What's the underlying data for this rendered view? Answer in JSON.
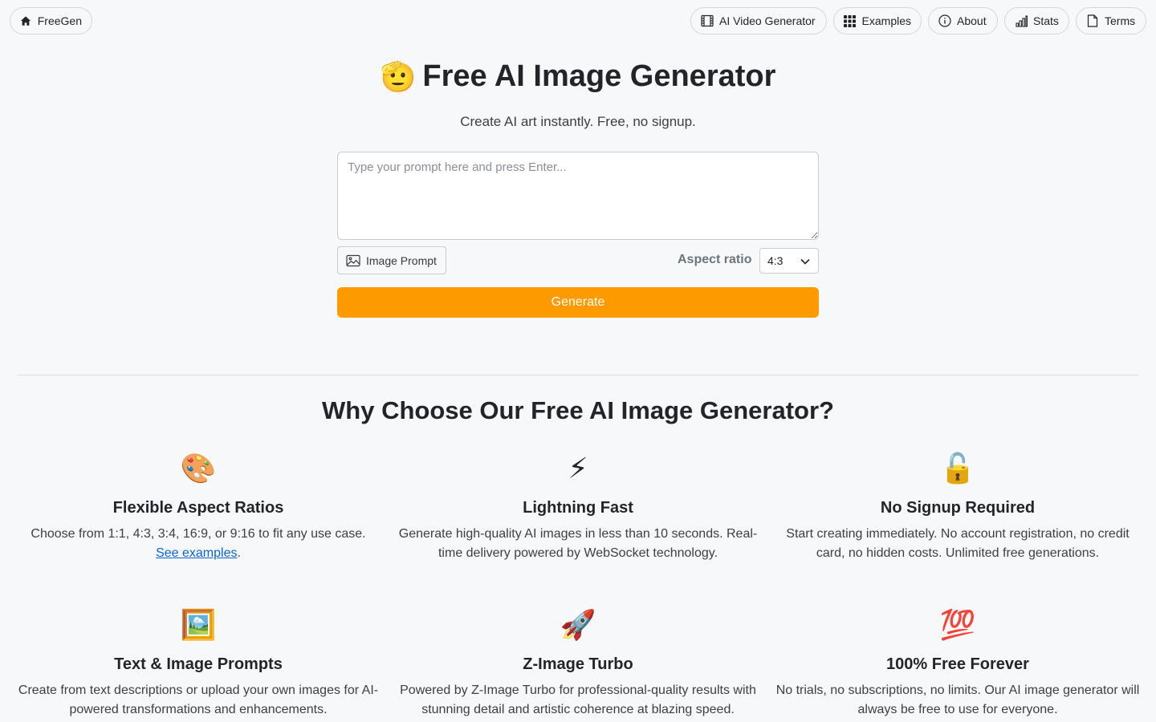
{
  "nav": {
    "home": "FreeGen",
    "video": "AI Video Generator",
    "examples": "Examples",
    "about": "About",
    "stats": "Stats",
    "terms": "Terms"
  },
  "hero": {
    "emoji": "🫡",
    "title": "Free AI Image Generator",
    "subtitle": "Create AI art instantly. Free, no signup."
  },
  "form": {
    "prompt_placeholder": "Type your prompt here and press Enter...",
    "prompt_value": "",
    "image_prompt_label": "Image Prompt",
    "aspect_ratio_label": "Aspect ratio",
    "aspect_ratio_value": "4:3",
    "generate_label": "Generate"
  },
  "colors": {
    "accent": "#fd9a00",
    "link": "#0b63d6",
    "background": "#f7f8fa"
  },
  "why": {
    "title": "Why Choose Our Free AI Image Generator?",
    "features": [
      {
        "icon": "palette-icon",
        "emoji": "🎨",
        "title": "Flexible Aspect Ratios",
        "desc": "Choose from 1:1, 4:3, 3:4, 16:9, or 9:16 to fit any use case.",
        "link": "See examples",
        "link_after": "."
      },
      {
        "icon": "lightning-icon",
        "emoji": "⚡",
        "title": "Lightning Fast",
        "desc": "Generate high-quality AI images in less than 10 seconds. Real-time delivery powered by WebSocket technology."
      },
      {
        "icon": "unlocked-icon",
        "emoji": "🔓",
        "title": "No Signup Required",
        "desc": "Start creating immediately. No account registration, no credit card, no hidden costs. Unlimited free generations."
      },
      {
        "icon": "framed-picture-icon",
        "emoji": "🖼️",
        "title": "Text & Image Prompts",
        "desc": "Create from text descriptions or upload your own images for AI-powered transformations and enhancements."
      },
      {
        "icon": "rocket-icon",
        "emoji": "🚀",
        "title": "Z-Image Turbo",
        "desc": "Powered by Z-Image Turbo for professional-quality results with stunning detail and artistic coherence at blazing speed."
      },
      {
        "icon": "hundred-points-icon",
        "emoji": "💯",
        "title": "100% Free Forever",
        "desc": "No trials, no subscriptions, no limits. Our AI image generator will always be free to use for everyone."
      }
    ]
  }
}
